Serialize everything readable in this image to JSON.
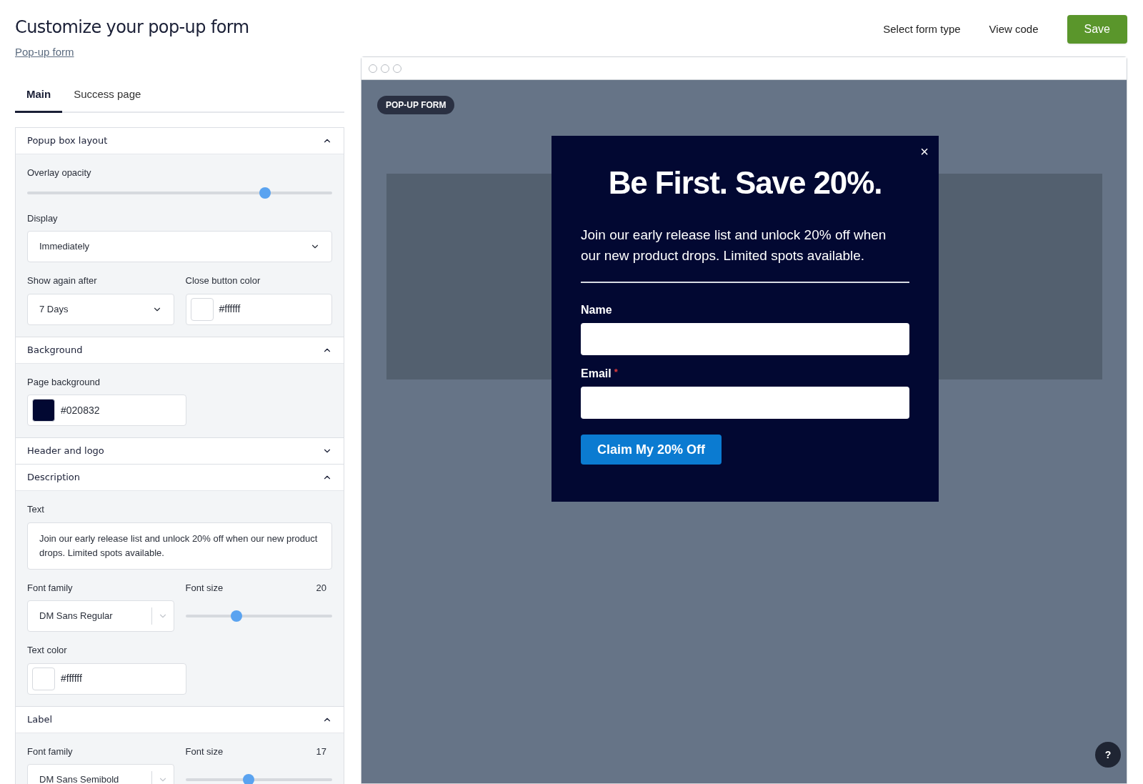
{
  "header": {
    "title": "Customize your pop-up form",
    "link": "Pop-up form",
    "actions": [
      "Select form type",
      "View code"
    ],
    "save": "Save"
  },
  "tabs": [
    {
      "label": "Main",
      "selected": true
    },
    {
      "label": "Success page",
      "selected": false
    }
  ],
  "sections": [
    {
      "title": "Popup box layout",
      "expanded": true,
      "rows": [
        [
          {
            "kind": "slider",
            "label": "Overlay opacity",
            "level": 0.78
          }
        ],
        [
          {
            "kind": "select",
            "label": "Display",
            "value": "Immediately"
          }
        ],
        [
          {
            "kind": "select",
            "label": "Show again after",
            "value": "7 Days"
          },
          {
            "kind": "color",
            "label": "Close button color",
            "value": "#ffffff",
            "color": "#ffffff"
          }
        ]
      ]
    },
    {
      "title": "Background",
      "expanded": true,
      "rows": [
        [
          {
            "kind": "color",
            "label": "Page background",
            "value": "#020832",
            "color": "#020832"
          }
        ]
      ]
    },
    {
      "title": "Header and logo",
      "expanded": false
    },
    {
      "title": "Description",
      "expanded": true,
      "rows": [
        [
          {
            "kind": "textarea",
            "label": "Text",
            "value": "Join our early release list and unlock 20% off when our new product drops. Limited spots available."
          }
        ],
        [
          {
            "kind": "combo",
            "label": "Font family",
            "value": "DM Sans Regular"
          },
          {
            "kind": "slider",
            "label": "Font size",
            "reading": "20",
            "level": 0.35
          }
        ],
        [
          {
            "kind": "color",
            "label": "Text color",
            "value": "#ffffff",
            "color": "#ffffff"
          }
        ]
      ]
    },
    {
      "title": "Label",
      "expanded": true,
      "rows": [
        [
          {
            "kind": "combo",
            "label": "Font family",
            "value": "DM Sans Semibold"
          },
          {
            "kind": "slider",
            "label": "Font size",
            "reading": "17",
            "level": 0.43
          }
        ]
      ]
    }
  ],
  "preview": {
    "badge": "POP-UP FORM",
    "close": "×",
    "heading": "Be First. Save 20%.",
    "description": "Join our early release list and unlock 20% off when our new product drops. Limited spots available.",
    "fields": [
      {
        "label": "Name",
        "required": false
      },
      {
        "label": "Email",
        "required": true
      }
    ],
    "required_mark": "*",
    "button": "Claim My 20% Off",
    "help": "?"
  }
}
